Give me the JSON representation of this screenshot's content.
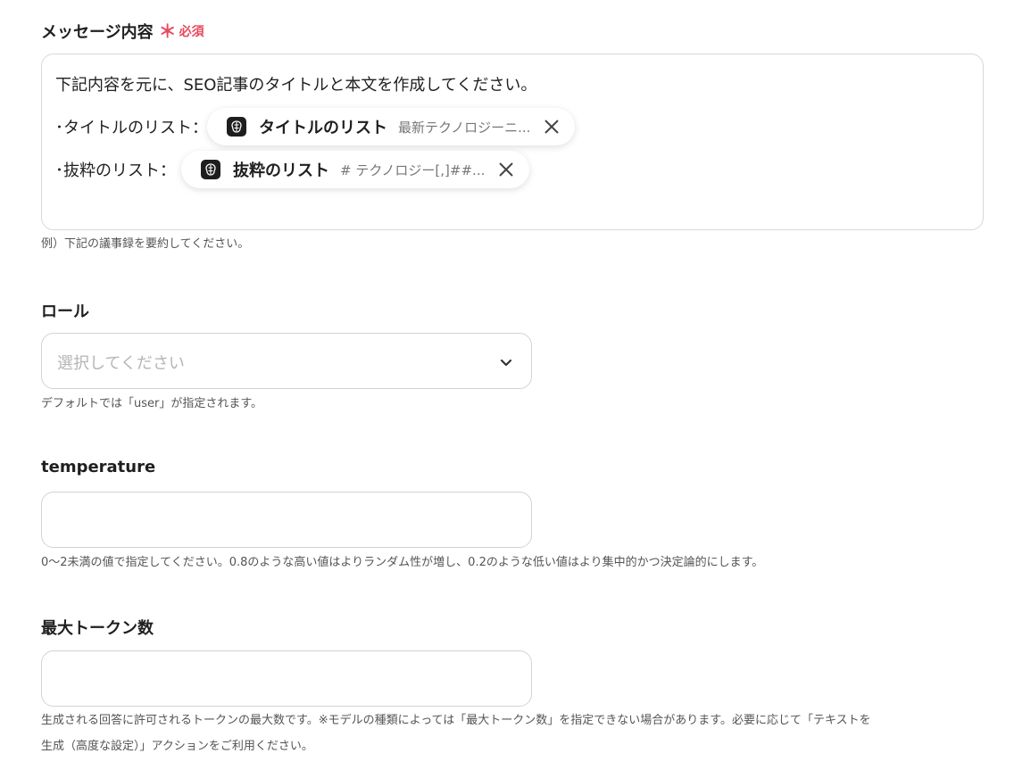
{
  "message": {
    "label": "メッセージ内容",
    "required_mark": "＊",
    "required_text": "必須",
    "line1": "下記内容を元に、SEO記事のタイトルと本文を作成してください。",
    "line2_prefix": "･タイトルのリスト：",
    "line3_prefix": "･抜粋のリスト：",
    "chip1": {
      "name": "タイトルのリスト",
      "preview": "最新テクノロジーニ..."
    },
    "chip2": {
      "name": "抜粋のリスト",
      "preview": "# テクノロジー[,]##..."
    },
    "help": "例）下記の議事録を要約してください。"
  },
  "role": {
    "label": "ロール",
    "placeholder": "選択してください",
    "help": "デフォルトでは「user」が指定されます。"
  },
  "temperature": {
    "label": "temperature",
    "value": "",
    "help": "0〜2未満の値で指定してください。0.8のような高い値はよりランダム性が増し、0.2のような低い値はより集中的かつ決定論的にします。"
  },
  "max_tokens": {
    "label": "最大トークン数",
    "value": "",
    "help_line1": "生成される回答に許可されるトークンの最大数です。※モデルの種類によっては「最大トークン数」を指定できない場合があります。必要に応じて「テキストを",
    "help_line2": "生成（高度な設定）」アクションをご利用ください。"
  },
  "colors": {
    "required": "#e8495d",
    "chip_icon_bg": "#1e1e1e"
  }
}
